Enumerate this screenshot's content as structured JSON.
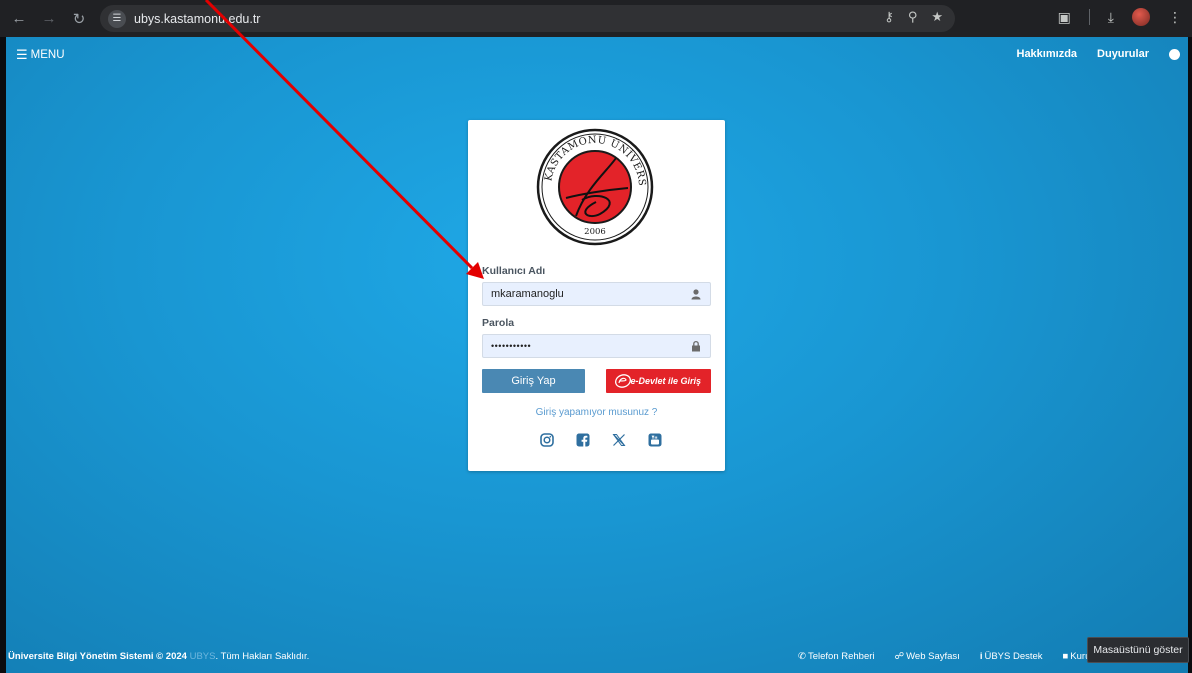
{
  "browser": {
    "url": "ubys.kastamonu.edu.tr",
    "back_icon": "arrow-left-icon",
    "forward_icon": "arrow-right-icon",
    "reload_icon": "reload-icon"
  },
  "topnav": {
    "menu_label": "MENU",
    "links": [
      "Hakkımızda",
      "Duyurular"
    ]
  },
  "login": {
    "logo": {
      "ring_text": "KASTAMONU ÜNİVERSİTESİ",
      "year": "2006",
      "colors": {
        "ring": "#1a1a1a",
        "disc": "#e32329"
      }
    },
    "username_label": "Kullanıcı Adı",
    "username_value": "mkaramanoglu",
    "password_label": "Parola",
    "password_value": "•••••••••••",
    "login_button": "Giriş Yap",
    "edevlet_button": "e-Devlet ile Giriş",
    "forgot_link": "Giriş yapamıyor musunuz ?",
    "social": [
      "instagram-icon",
      "facebook-icon",
      "x-icon",
      "youtube-icon"
    ]
  },
  "footer": {
    "copyright_bold": "Üniversite Bilgi Yönetim Sistemi © 2024",
    "copyright_mark": "UBYS",
    "copyright_rest": ". Tüm Hakları Saklıdır.",
    "links": [
      "Telefon Rehberi",
      "Web Sayfası",
      "ÜBYS Destek",
      "Kurum"
    ]
  },
  "tooltip": "Masaüstünü göster",
  "colors": {
    "background": "#1996d2",
    "primary_button": "#4a88b3",
    "edevlet_button": "#e32329",
    "annotation_arrow": "#e30000"
  }
}
